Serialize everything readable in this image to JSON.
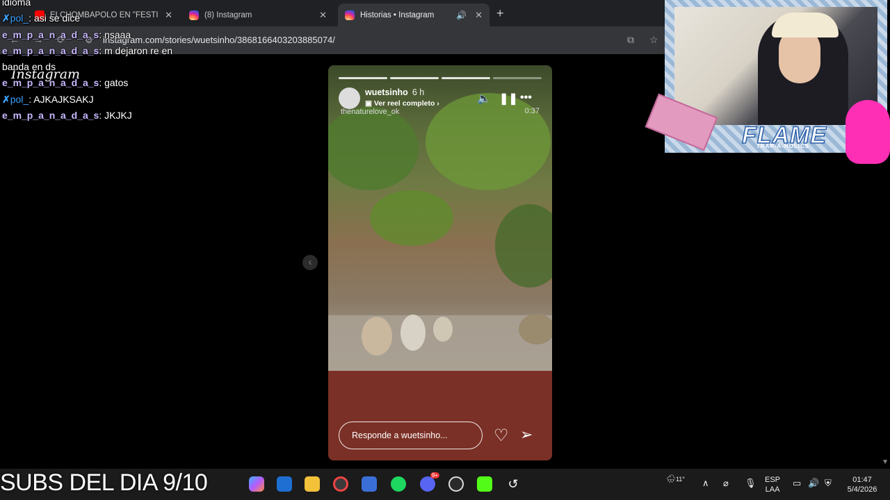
{
  "tabs": [
    {
      "title": "ELCHOMBAPOLO EN \"FESTI",
      "icon": "youtube-icon"
    },
    {
      "title": "(8) Instagram",
      "icon": "instagram-icon"
    },
    {
      "title": "Historias • Instagram",
      "icon": "instagram-icon",
      "active": true
    }
  ],
  "address_bar": {
    "url": "instagram.com/stories/wuetsinho/3868166403203885074/"
  },
  "chat": {
    "messages": [
      {
        "text": "idioma"
      },
      {
        "user": "pol_",
        "text": ": asi se dice"
      },
      {
        "user": "e_m_p_a_n_a_d_a_s",
        "text": ": nsaaa"
      },
      {
        "user": "e_m_p_a_n_a_d_a_s",
        "text": ": m dejaron re en"
      },
      {
        "text": "banda en ds"
      },
      {
        "user": "e_m_p_a_n_a_d_a_s",
        "text": ": gatos"
      },
      {
        "user": "pol_",
        "text": ": AJKAJKSAKJ"
      },
      {
        "user": "e_m_p_a_n_a_d_a_s",
        "text": ": JKJKJ"
      }
    ]
  },
  "instagram": {
    "logo": "Instagram"
  },
  "story": {
    "username": "wuetsinho",
    "time": "6 h",
    "reel_link": "Ver reel completo",
    "credit": "thenaturelove_ok",
    "duration": "0:37",
    "reply_placeholder": "Responde a wuetsinho...",
    "progress_segments": 4
  },
  "overlay": {
    "title": "FLAME",
    "subtitle": "TRAP-A-HOLICS",
    "banner": "SUBS DEL DIA 9/10"
  },
  "taskbar": {
    "language": "ESP",
    "layout": "LAA",
    "time": "01:47",
    "date": "5/4/2026",
    "temperature": "11°",
    "discord_badge": "9+"
  }
}
